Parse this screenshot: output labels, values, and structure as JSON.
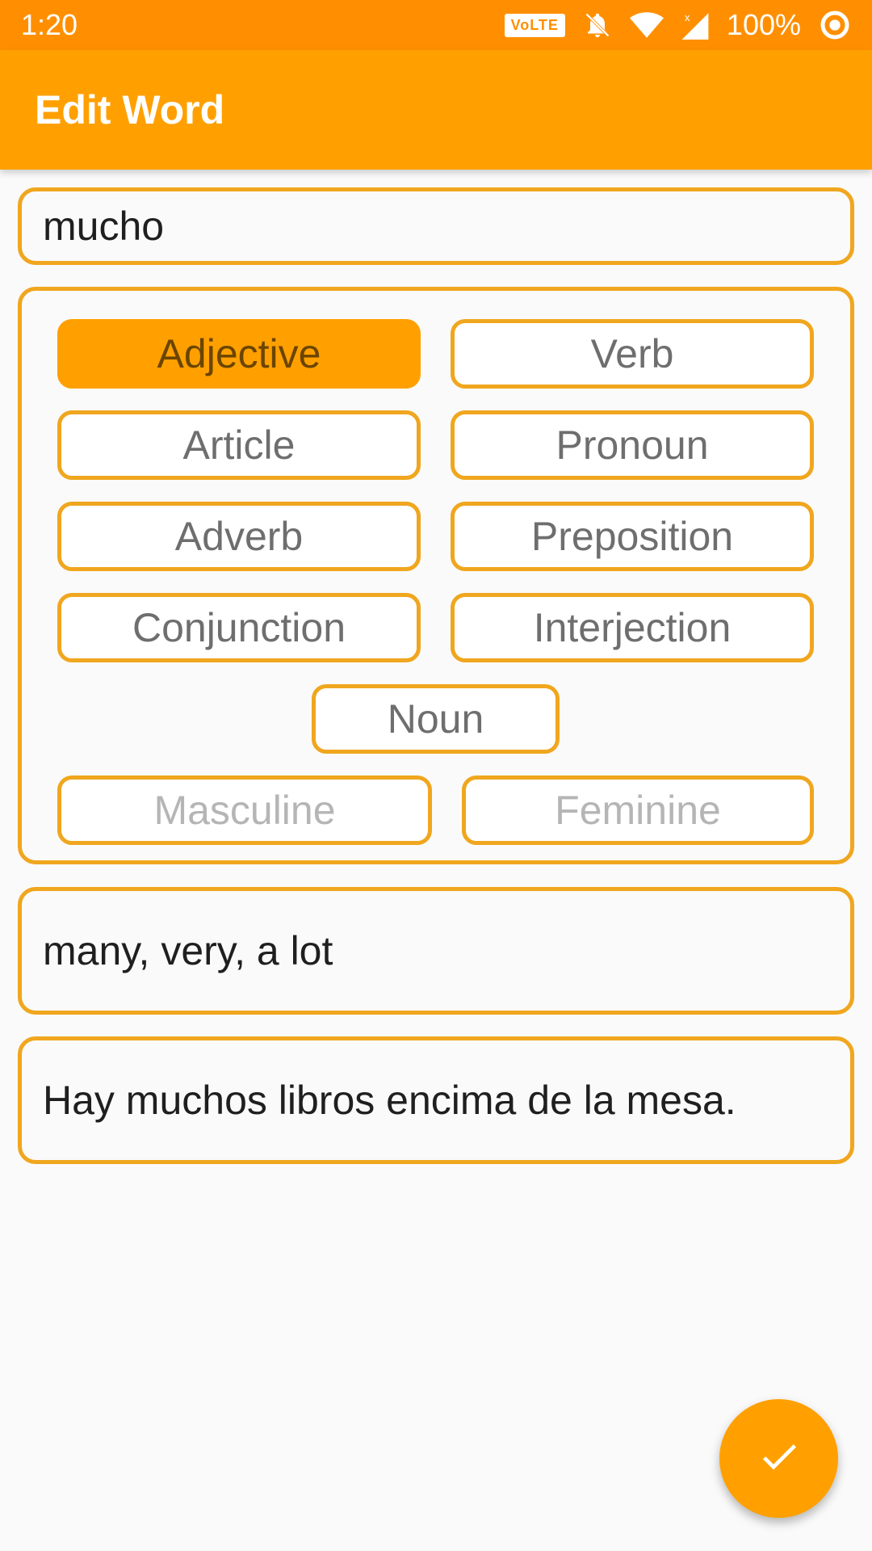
{
  "status_bar": {
    "time": "1:20",
    "volte": "VoLTE",
    "battery": "100%"
  },
  "app_bar": {
    "title": "Edit Word"
  },
  "word": {
    "value": "mucho"
  },
  "parts_of_speech": {
    "adjective": "Adjective",
    "verb": "Verb",
    "article": "Article",
    "pronoun": "Pronoun",
    "adverb": "Adverb",
    "preposition": "Preposition",
    "conjunction": "Conjunction",
    "interjection": "Interjection",
    "noun": "Noun",
    "selected": "Adjective"
  },
  "gender": {
    "masculine": "Masculine",
    "feminine": "Feminine"
  },
  "meaning": {
    "value": "many, very, a lot"
  },
  "example": {
    "value": "Hay muchos libros encima de la mesa."
  },
  "fab": {
    "icon": "check-icon"
  },
  "colors": {
    "primary": "#ffa000",
    "primary_dark": "#ff8f00",
    "outline": "#f0a61e"
  }
}
